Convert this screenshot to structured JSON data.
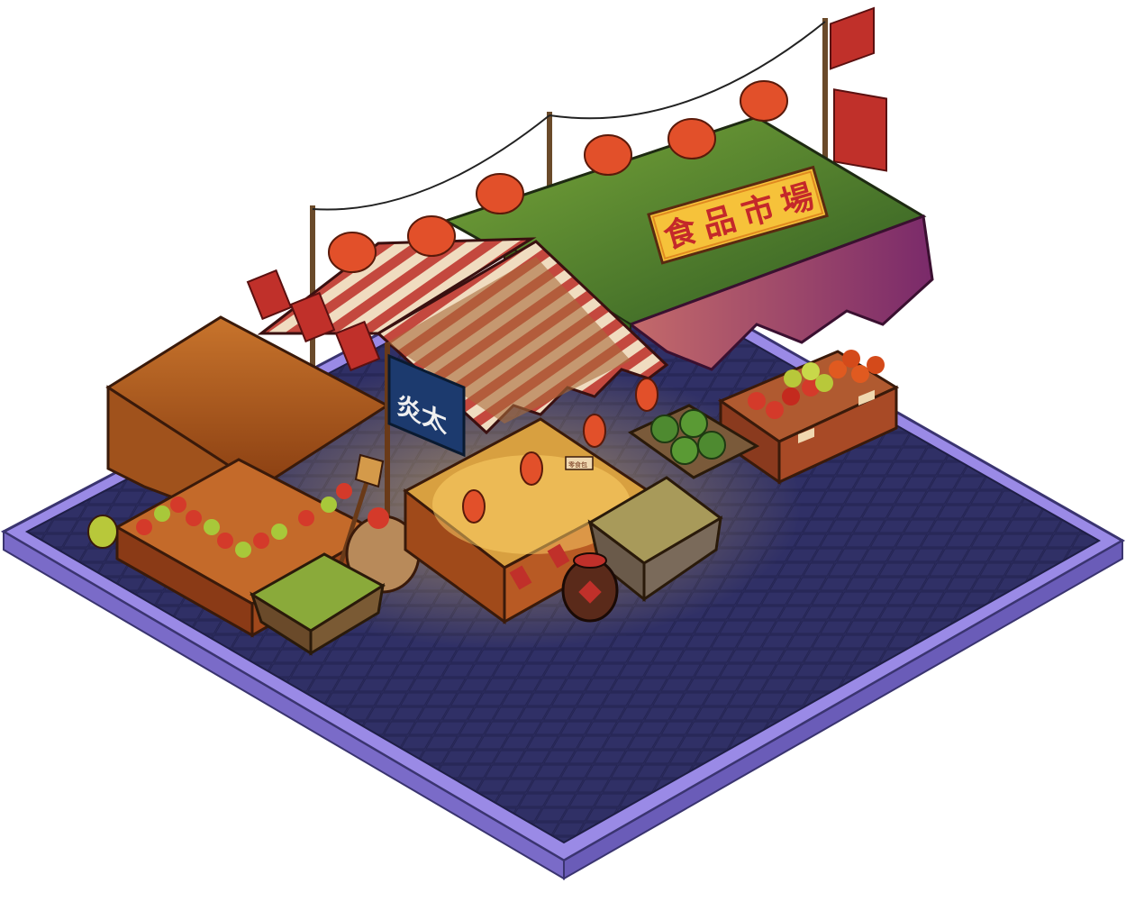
{
  "scene": {
    "main_sign": [
      "食",
      "品",
      "市",
      "場"
    ],
    "blue_sign": "炎太",
    "price_tag": "零食包",
    "colors": {
      "ground_border": "#8f7ee0",
      "ground_fill": "#2a2a5c",
      "awning_green": "#4f8a2e",
      "awning_magenta": "#8e3a7a",
      "awning_orange": "#b55e1c",
      "stripe_red": "#c4483e",
      "stripe_cream": "#f0dcc0",
      "lantern": "#e2502a",
      "sign_yellow": "#f6c23a",
      "sign_blue": "#1c3a6e"
    },
    "icons": [
      "red-lantern",
      "red-flag",
      "apple-crate",
      "watermelon-crate",
      "broom",
      "sack",
      "wine-jar"
    ]
  }
}
